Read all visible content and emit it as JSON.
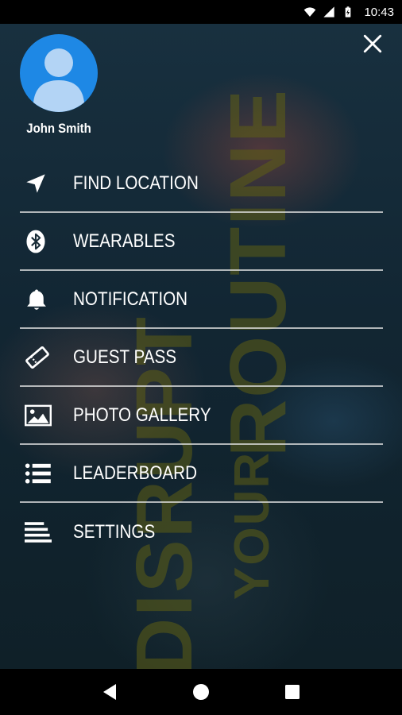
{
  "status_bar": {
    "time": "10:43",
    "icons": [
      "wifi-icon",
      "cellular-signal-icon",
      "battery-icon"
    ]
  },
  "drawer": {
    "close_icon": "close-icon",
    "user": {
      "avatar_icon": "person-icon",
      "name": "John Smith"
    },
    "menu": [
      {
        "label": "FIND LOCATION",
        "icon": "navigation-arrow-icon"
      },
      {
        "label": "WEARABLES",
        "icon": "bluetooth-icon"
      },
      {
        "label": "NOTIFICATION",
        "icon": "bell-icon"
      },
      {
        "label": "GUEST PASS",
        "icon": "ticket-icon"
      },
      {
        "label": "PHOTO GALLERY",
        "icon": "image-icon"
      },
      {
        "label": "LEADERBOARD",
        "icon": "list-icon"
      },
      {
        "label": "SETTINGS",
        "icon": "text-lines-icon"
      }
    ],
    "background_text": [
      "DISRUPT",
      "YOUR",
      "ROUTINE"
    ]
  },
  "nav_bar": {
    "icons": [
      "back-icon",
      "home-icon",
      "recents-icon"
    ]
  },
  "colors": {
    "avatar": "#1e88e5",
    "background_text": "#5f5f14",
    "divider": "#e6e6e6"
  }
}
